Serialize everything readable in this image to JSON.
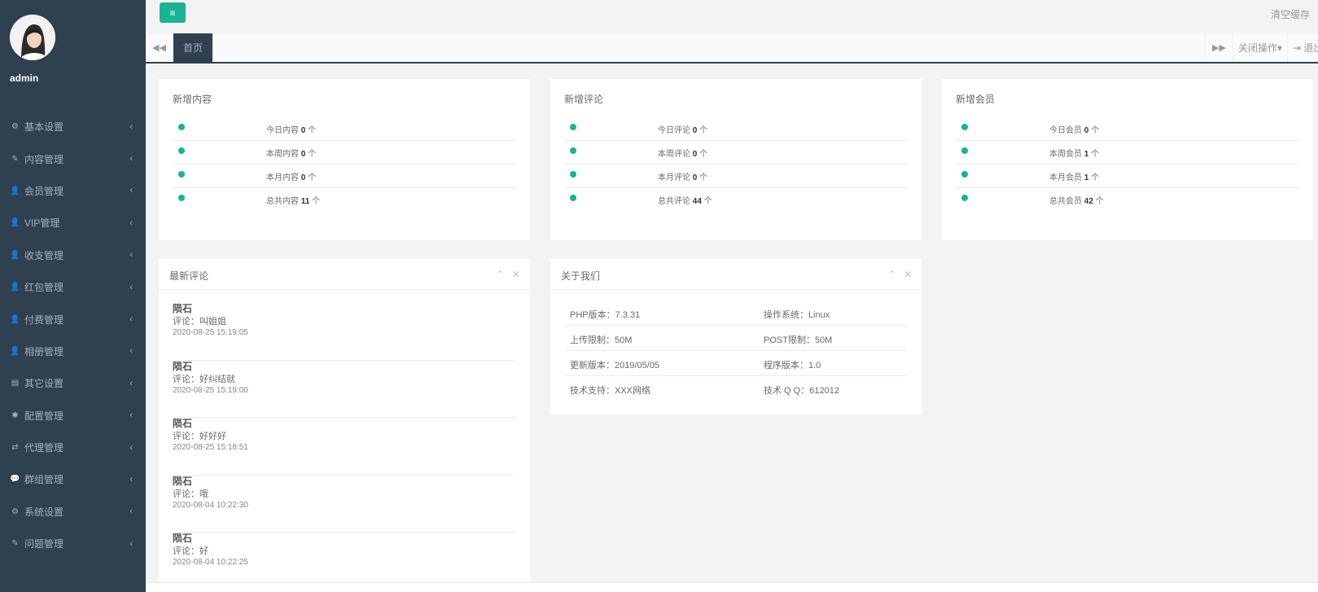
{
  "user": {
    "name": "admin",
    "avatar_icon": "user-avatar"
  },
  "sidebar": {
    "items": [
      {
        "label": "基本设置",
        "icon": "⚙"
      },
      {
        "label": "内容管理",
        "icon": "✎"
      },
      {
        "label": "会员管理",
        "icon": "👤"
      },
      {
        "label": "VIP管理",
        "icon": "👤"
      },
      {
        "label": "收支管理",
        "icon": "👤"
      },
      {
        "label": "红包管理",
        "icon": "👤"
      },
      {
        "label": "付费管理",
        "icon": "👤"
      },
      {
        "label": "相册管理",
        "icon": "👤"
      },
      {
        "label": "其它设置",
        "icon": "▤"
      },
      {
        "label": "配置管理",
        "icon": "✱"
      },
      {
        "label": "代理管理",
        "icon": "⇄"
      },
      {
        "label": "群组管理",
        "icon": "💬"
      },
      {
        "label": "系统设置",
        "icon": "⚙"
      },
      {
        "label": "问题管理",
        "icon": "✎"
      }
    ],
    "arrow": "‹"
  },
  "topbar": {
    "menu_icon": "≡",
    "clear_cache": "清空缓存"
  },
  "tabs": {
    "left_icon": "◀◀",
    "home": "首页",
    "right_icon": "▶▶",
    "close_ops": "关闭操作▾",
    "exit": "⇥ 退出"
  },
  "stats": [
    {
      "title": "新增内容",
      "rows": [
        {
          "label": "今日内容",
          "value": "0",
          "unit": "个"
        },
        {
          "label": "本周内容",
          "value": "0",
          "unit": "个"
        },
        {
          "label": "本月内容",
          "value": "0",
          "unit": "个"
        },
        {
          "label": "总共内容",
          "value": "11",
          "unit": "个"
        }
      ]
    },
    {
      "title": "新增评论",
      "rows": [
        {
          "label": "今日评论",
          "value": "0",
          "unit": "个"
        },
        {
          "label": "本周评论",
          "value": "0",
          "unit": "个"
        },
        {
          "label": "本月评论",
          "value": "0",
          "unit": "个"
        },
        {
          "label": "总共评论",
          "value": "44",
          "unit": "个"
        }
      ]
    },
    {
      "title": "新增会员",
      "rows": [
        {
          "label": "今日会员",
          "value": "0",
          "unit": "个"
        },
        {
          "label": "本周会员",
          "value": "1",
          "unit": "个"
        },
        {
          "label": "本月会员",
          "value": "1",
          "unit": "个"
        },
        {
          "label": "总共会员",
          "value": "42",
          "unit": "个"
        }
      ]
    }
  ],
  "latest_comments": {
    "title": "最新评论",
    "collapse_icon": "⌃",
    "close_icon": "✕",
    "items": [
      {
        "author": "陨石",
        "text": "评论：叫姐姐",
        "time": "2020-08-25 15:19:05"
      },
      {
        "author": "陨石",
        "text": "评论：好纠结就",
        "time": "2020-08-25 15:19:00"
      },
      {
        "author": "陨石",
        "text": "评论：好好好",
        "time": "2020-08-25 15:18:51"
      },
      {
        "author": "陨石",
        "text": "评论：哦",
        "time": "2020-08-04 10:22:30"
      },
      {
        "author": "陨石",
        "text": "评论：好",
        "time": "2020-08-04 10:22:25"
      }
    ]
  },
  "about": {
    "title": "关于我们",
    "collapse_icon": "⌃",
    "close_icon": "✕",
    "rows": [
      {
        "left": "PHP版本：7.3.31",
        "right": "操作系统：Linux"
      },
      {
        "left": "上传限制：50M",
        "right": "POST限制：50M"
      },
      {
        "left": "更新版本：2019/05/05",
        "right": "程序版本：1.0"
      },
      {
        "left": "技术支持：XXX网络",
        "right": "技术 Q Q：612012"
      }
    ]
  },
  "colors": {
    "sidebar": "#2f4050",
    "accent": "#1ab394",
    "background": "#f3f3f4"
  }
}
